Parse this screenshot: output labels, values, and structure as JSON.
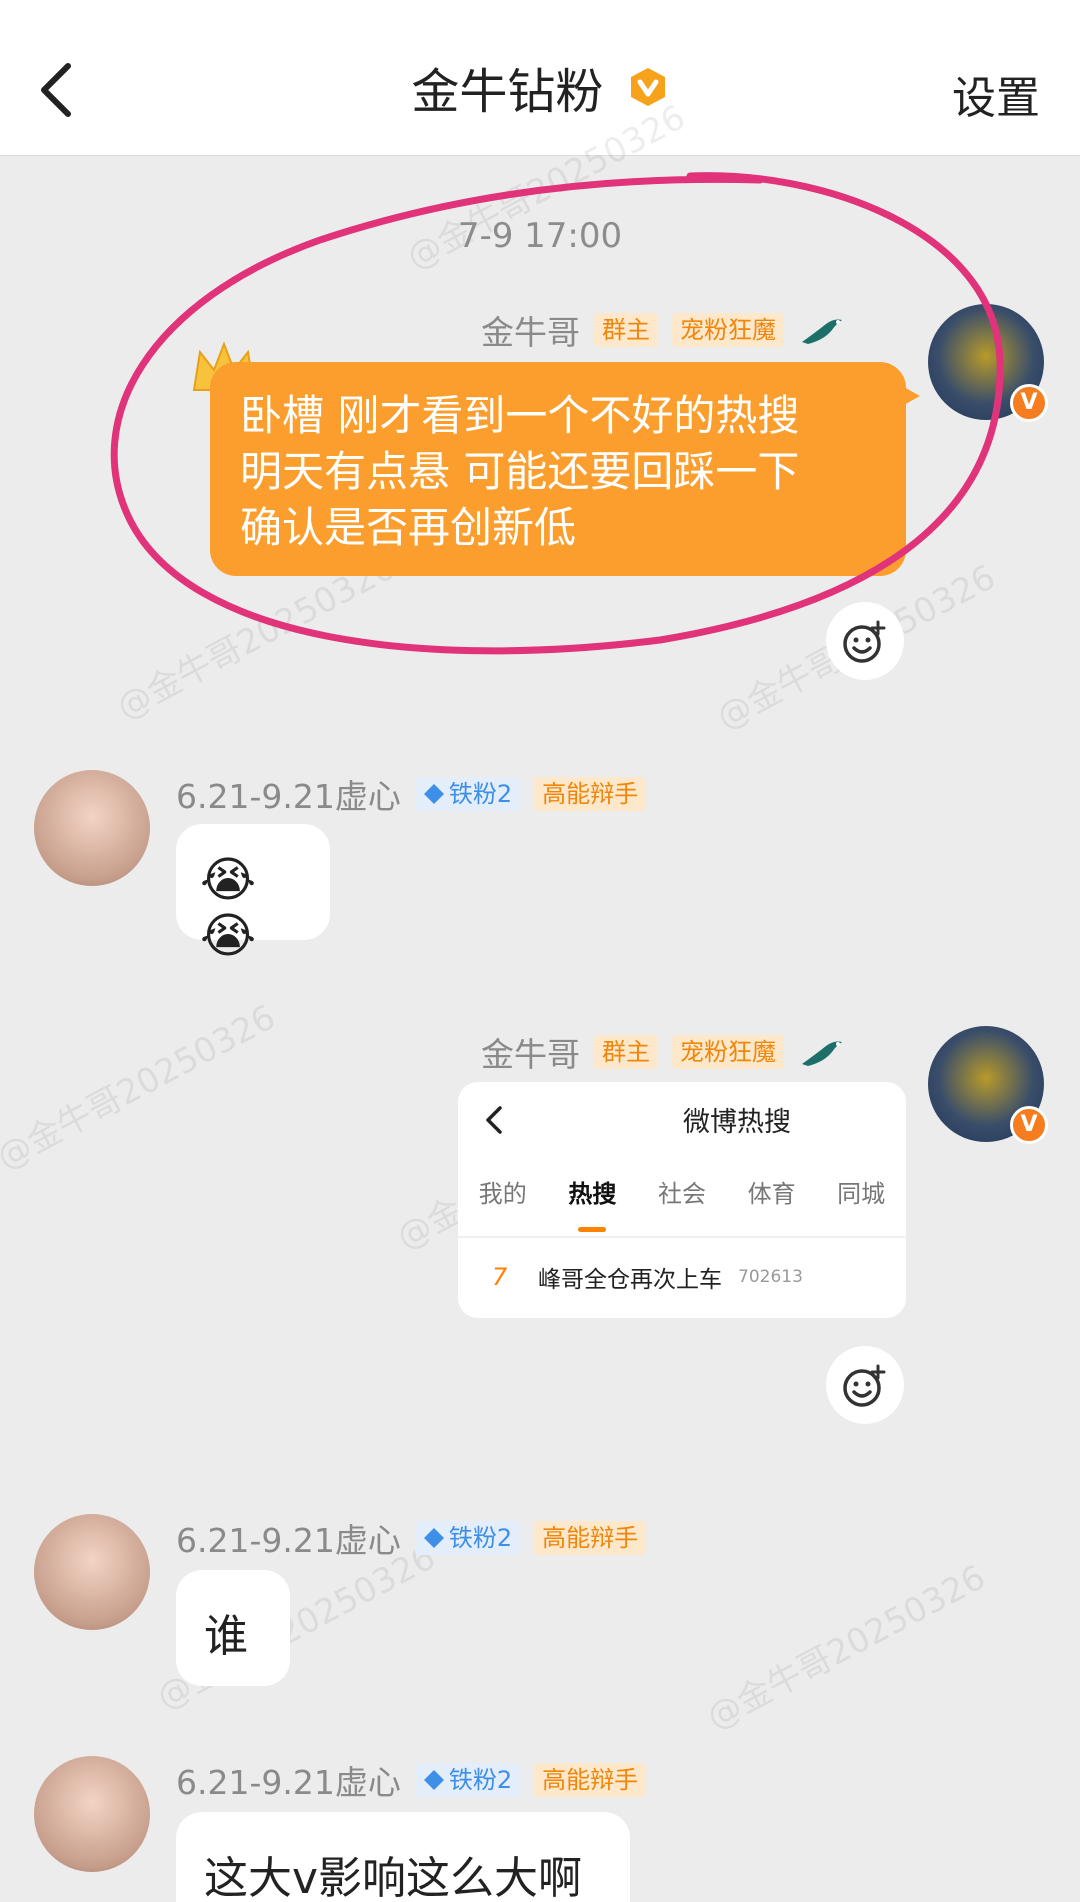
{
  "header": {
    "title": "金牛钻粉",
    "settings_label": "设置"
  },
  "watermark_text": "@金牛哥20250326",
  "timestamp": "7-9 17:00",
  "messages": [
    {
      "sender": "金牛哥",
      "tags": [
        "群主",
        "宠粉狂魔"
      ],
      "text_lines": [
        "卧槽 刚才看到一个不好的热搜",
        "明天有点悬 可能还要回踩一下",
        "确认是否再创新低"
      ]
    },
    {
      "sender": "6.21-9.21虚心",
      "fan_badge": "铁粉2",
      "title_tag": "高能辩手",
      "emoji": "😭😭"
    },
    {
      "sender": "金牛哥",
      "tags": [
        "群主",
        "宠粉狂魔"
      ],
      "card": {
        "title": "微博热搜",
        "tabs": [
          "我的",
          "热搜",
          "社会",
          "体育",
          "同城"
        ],
        "active_tab": "热搜",
        "rank": "7",
        "topic": "峰哥全仓再次上车",
        "heat": "702613"
      }
    },
    {
      "sender": "6.21-9.21虚心",
      "fan_badge": "铁粉2",
      "title_tag": "高能辩手",
      "text": "谁"
    },
    {
      "sender": "6.21-9.21虚心",
      "fan_badge": "铁粉2",
      "title_tag": "高能辩手",
      "text": "这大v影响这么大啊"
    }
  ],
  "colors": {
    "accent": "#fb9e2e",
    "annotation_circle": "#e0337a",
    "verified": "#f57c1f"
  }
}
